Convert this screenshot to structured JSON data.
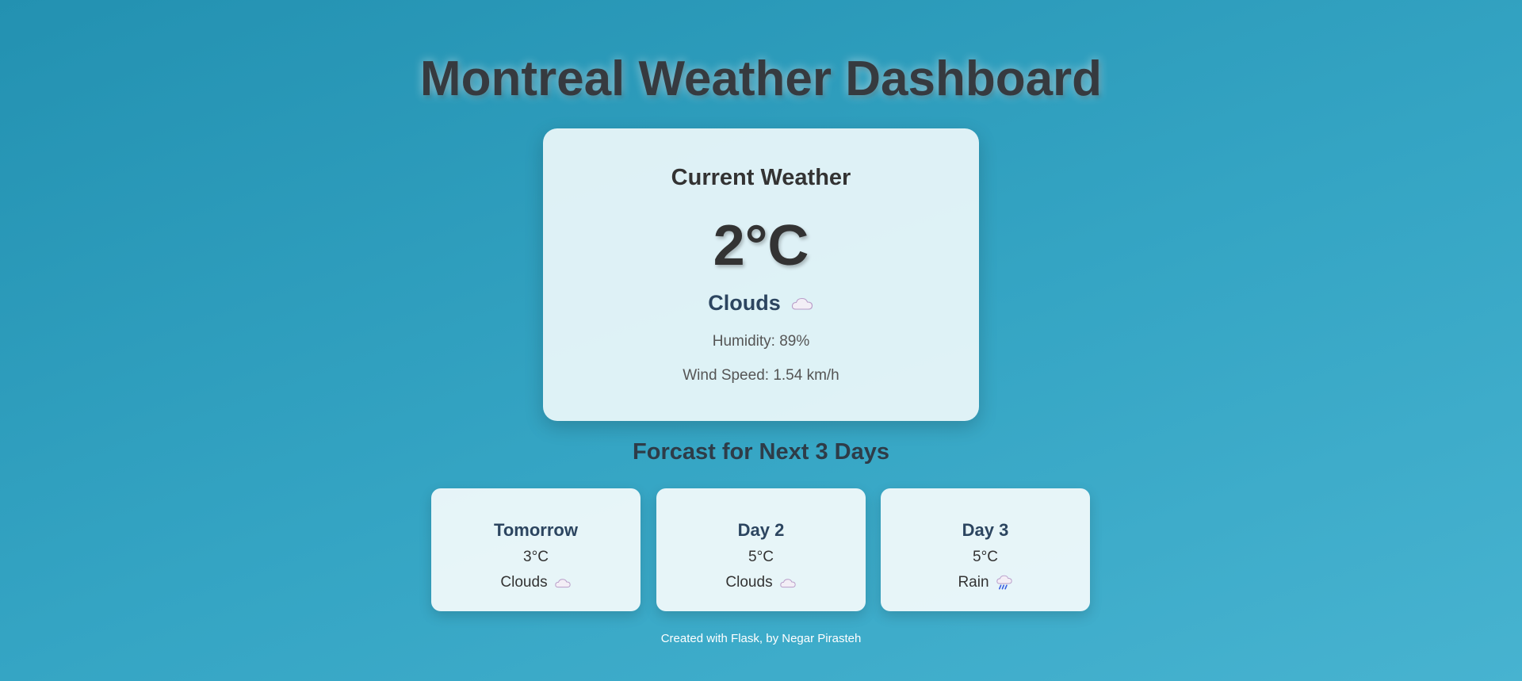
{
  "page": {
    "title": "Montreal Weather Dashboard",
    "background_colors": [
      "#2391b1",
      "#47b3d0"
    ]
  },
  "current": {
    "heading": "Current Weather",
    "temperature": "2°C",
    "condition": "Clouds",
    "condition_icon": "cloud-icon",
    "humidity": "Humidity: 89%",
    "wind_speed": "Wind Speed: 1.54 km/h"
  },
  "forecast": {
    "heading": "Forcast for Next 3 Days",
    "days": [
      {
        "label": "Tomorrow",
        "temperature": "3°C",
        "condition": "Clouds",
        "icon": "cloud-icon"
      },
      {
        "label": "Day 2",
        "temperature": "5°C",
        "condition": "Clouds",
        "icon": "cloud-icon"
      },
      {
        "label": "Day 3",
        "temperature": "5°C",
        "condition": "Rain",
        "icon": "rain-cloud-icon"
      }
    ]
  },
  "footer": {
    "text": "Created with Flask, by Negar Pirasteh"
  }
}
